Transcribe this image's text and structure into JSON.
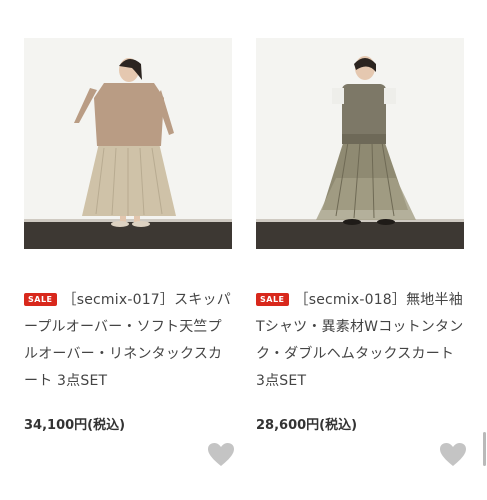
{
  "products": [
    {
      "badge": "SALE",
      "title": "［secmix-017］スキッパープルオーバー・ソフト天竺プルオーバー・リネンタックスカート 3点SET",
      "price": "34,100円(税込)",
      "image_icon": "product-photo"
    },
    {
      "badge": "SALE",
      "title": "［secmix-018］無地半袖Tシャツ・異素材Wコットンタンク・ダブルヘムタックスカート 3点SET",
      "price": "28,600円(税込)",
      "image_icon": "product-photo"
    }
  ],
  "icons": {
    "favorite": "heart-icon"
  },
  "colors": {
    "sale_badge": "#d8281c",
    "heart": "#c4c4c4",
    "floor": "#3b3530"
  }
}
